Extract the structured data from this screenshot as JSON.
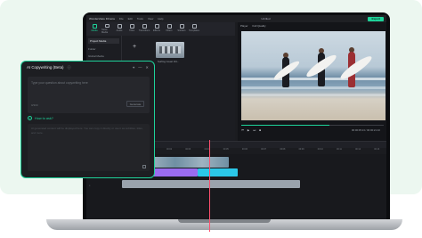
{
  "titlebar": {
    "app_name": "Wondershare Filmora",
    "menus": [
      "File",
      "Edit",
      "Tools",
      "View",
      "Help"
    ],
    "project": "Untitled",
    "export_label": "Export"
  },
  "toolbar": {
    "items": [
      {
        "label": "Media",
        "active": true
      },
      {
        "label": "Stock Media",
        "active": false
      },
      {
        "label": "Audio",
        "active": false
      },
      {
        "label": "Titles",
        "active": false
      },
      {
        "label": "Transitions",
        "active": false
      },
      {
        "label": "Effects",
        "active": false
      },
      {
        "label": "Filters",
        "active": false
      },
      {
        "label": "Stickers",
        "active": false
      },
      {
        "label": "Templates",
        "active": false
      }
    ]
  },
  "library": {
    "side_items": [
      "Project Media",
      "Folder",
      "Global Media",
      "Cloud Media",
      "Influence Kit",
      "Adjustment Layer"
    ],
    "add_label": "+",
    "media_name": "Surfing Coast Vid..."
  },
  "player": {
    "tabs": [
      "Player",
      "Full Quality"
    ],
    "time_current": "00:00:05:13",
    "time_total": "00:00:21:10",
    "progress": 0.62
  },
  "timeline": {
    "tools": [
      "↶",
      "↷",
      "✂",
      "⌫",
      "T",
      "▦",
      "◉",
      "⊕"
    ],
    "ruler": [
      "00:00",
      "00:01",
      "00:02",
      "00:03",
      "00:04",
      "00:05",
      "00:06",
      "00:07",
      "00:08",
      "00:09",
      "00:10",
      "00:11",
      "00:12",
      "00:13"
    ],
    "track_icons": [
      "▶",
      "▶",
      "♪"
    ]
  },
  "popup": {
    "title": "AI Copywriting (Beta)",
    "info_icon": "info-icon",
    "placeholder": "Type your question about copywriting here",
    "char_count": "0/300",
    "generate_label": "Generate",
    "howto_label": "How to ask?",
    "result_placeholder": "AI generated content will be displayed here. You can copy it directly or use it as subtitles, titles, and more."
  },
  "colors": {
    "accent": "#1ed39a",
    "playhead": "#ff4f6d",
    "background_panel": "#ecf7f0"
  }
}
